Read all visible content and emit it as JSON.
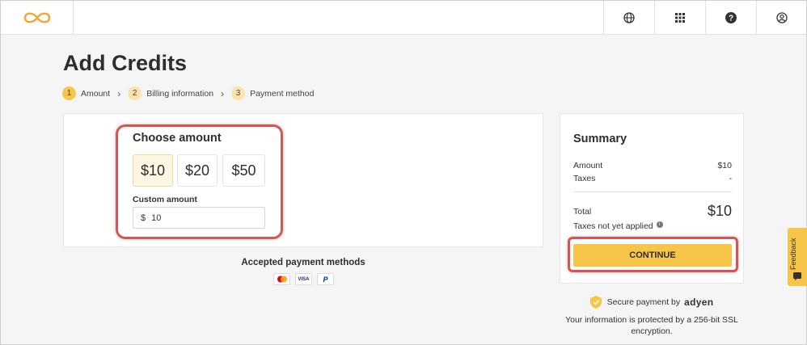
{
  "header": {
    "logo_icon": "infinity-logo-icon",
    "icons": [
      "globe-icon",
      "apps-grid-icon",
      "help-icon",
      "account-icon"
    ]
  },
  "page": {
    "title": "Add Credits"
  },
  "stepper": {
    "steps": [
      {
        "num": "1",
        "label": "Amount"
      },
      {
        "num": "2",
        "label": "Billing information"
      },
      {
        "num": "3",
        "label": "Payment method"
      }
    ],
    "separator": "›"
  },
  "amount": {
    "title": "Choose amount",
    "options": [
      "$10",
      "$20",
      "$50"
    ],
    "selected": "$10",
    "custom_label": "Custom amount",
    "currency": "$",
    "custom_value": "10"
  },
  "payment_methods": {
    "title": "Accepted payment methods",
    "cards": [
      "mastercard-icon",
      "visa-icon",
      "paypal-icon"
    ],
    "visa_text": "VISA",
    "paypal_text": "P"
  },
  "summary": {
    "title": "Summary",
    "amount_label": "Amount",
    "amount_value": "$10",
    "taxes_label": "Taxes",
    "taxes_value": "-",
    "total_label": "Total",
    "total_value": "$10",
    "taxes_note": "Taxes not yet applied",
    "continue_label": "CONTINUE"
  },
  "secure": {
    "text": "Secure payment by",
    "provider": "adyen",
    "ssl_text": "Your information is protected by a 256-bit SSL encryption."
  },
  "feedback": {
    "label": "Feedback"
  },
  "colors": {
    "accent": "#f7c548",
    "highlight": "#d9534f",
    "text": "#2e2e2e"
  }
}
